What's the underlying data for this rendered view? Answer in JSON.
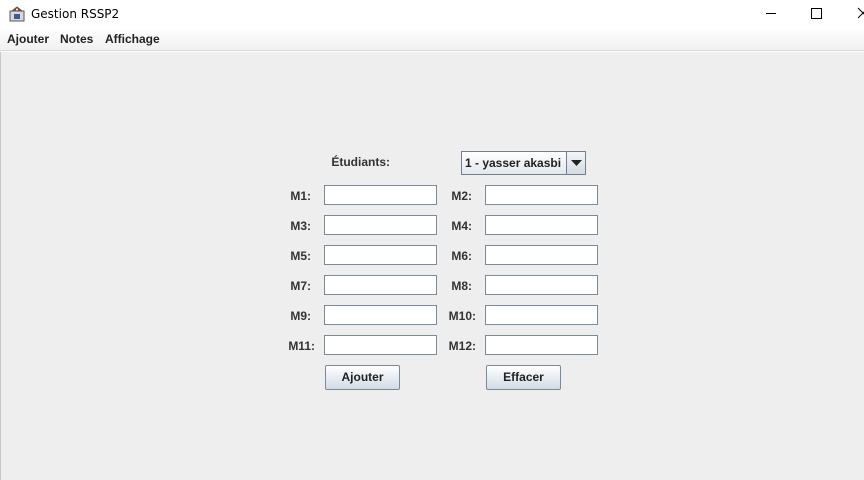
{
  "window": {
    "title": "Gestion RSSP2"
  },
  "menubar": {
    "items": [
      {
        "label": "Ajouter"
      },
      {
        "label": "Notes"
      },
      {
        "label": "Affichage"
      }
    ]
  },
  "form": {
    "students_label": "Étudiants:",
    "student_selected": "1 - yasser akasbi",
    "fields": [
      {
        "label": "M1:",
        "value": ""
      },
      {
        "label": "M2:",
        "value": ""
      },
      {
        "label": "M3:",
        "value": ""
      },
      {
        "label": "M4:",
        "value": ""
      },
      {
        "label": "M5:",
        "value": ""
      },
      {
        "label": "M6:",
        "value": ""
      },
      {
        "label": "M7:",
        "value": ""
      },
      {
        "label": "M8:",
        "value": ""
      },
      {
        "label": "M9:",
        "value": ""
      },
      {
        "label": "M10:",
        "value": ""
      },
      {
        "label": "M11:",
        "value": ""
      },
      {
        "label": "M12:",
        "value": ""
      }
    ],
    "add_button": "Ajouter",
    "clear_button": "Effacer"
  },
  "icons": {
    "app": "java-app-icon",
    "minimize": "minimize-icon",
    "maximize": "maximize-icon",
    "close": "close-icon",
    "dropdown": "triangle-down-icon"
  }
}
